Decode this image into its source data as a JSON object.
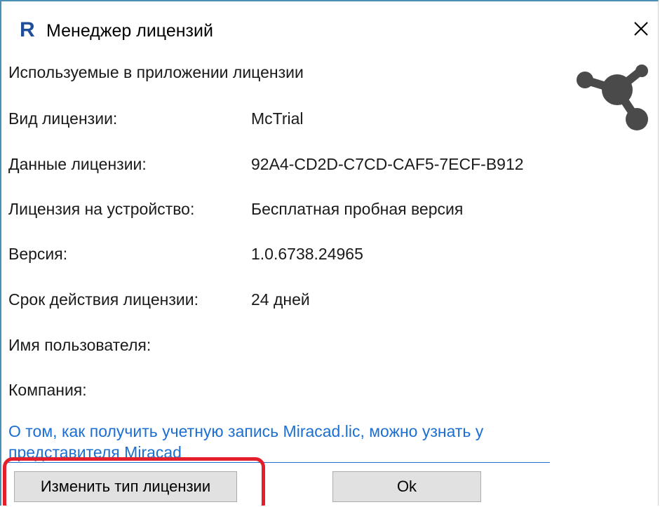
{
  "window": {
    "app_icon_letter": "R",
    "title": "Менеджер лицензий"
  },
  "section_title": "Используемые в приложении лицензии",
  "fields": [
    {
      "label": "Вид лицензии:",
      "value": "McTrial"
    },
    {
      "label": "Данные лицензии:",
      "value": "92A4-CD2D-C7CD-CAF5-7ECF-B912"
    },
    {
      "label": "Лицензия на устройство:",
      "value": "Бесплатная пробная версия"
    },
    {
      "label": "Версия:",
      "value": "1.0.6738.24965"
    },
    {
      "label": "Срок действия лицензии:",
      "value": "24 дней"
    },
    {
      "label": "Имя пользователя:",
      "value": ""
    },
    {
      "label": "Компания:",
      "value": ""
    }
  ],
  "info_link": "О том, как получить учетную запись Miracad.lic, можно узнать у представителя Miracad",
  "buttons": {
    "change_license": "Изменить тип лицензии",
    "ok": "Ok"
  },
  "colors": {
    "link": "#1c6fd1",
    "highlight": "#e41e2a",
    "icon": "#4a4a4a",
    "app_icon": "#1f4f9a"
  }
}
